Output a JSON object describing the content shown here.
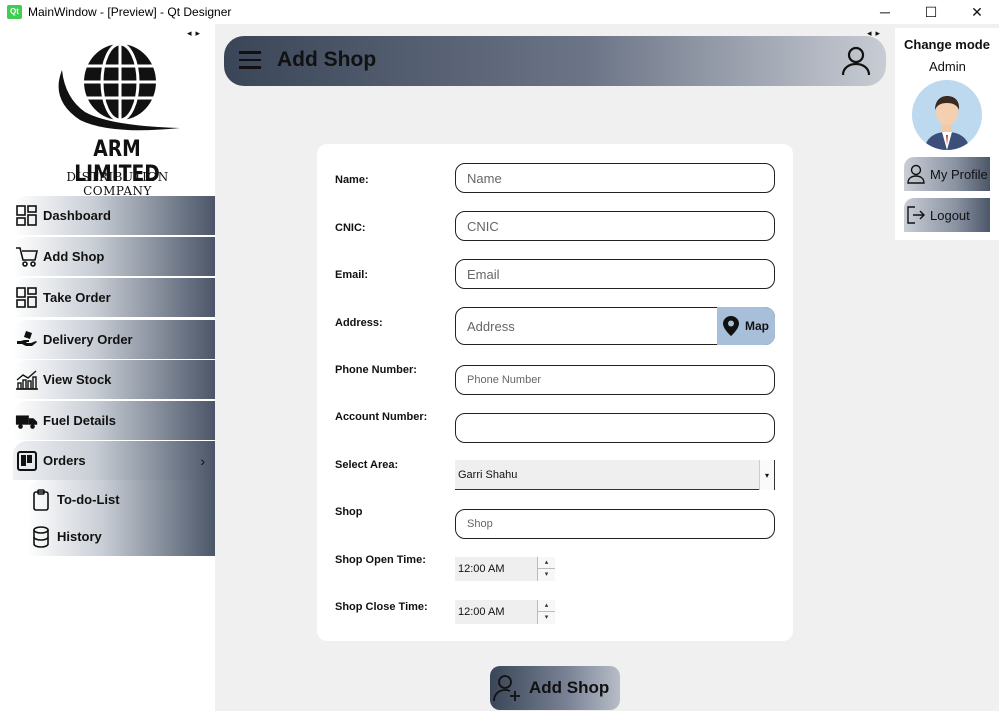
{
  "window": {
    "title": "MainWindow - [Preview] - Qt Designer",
    "qt_logo_text": "Qt",
    "minimize_glyph": "─",
    "maximize_glyph": "☐",
    "close_glyph": "✕"
  },
  "splitter_arrows": "◂▸",
  "brand": {
    "name": "ARM LIMITED",
    "subtitle": "DISTRIBUTION COMPANY"
  },
  "sidebar": {
    "items": [
      {
        "label": "Dashboard",
        "icon": "dashboard-grid-icon"
      },
      {
        "label": "Add Shop",
        "icon": "cart-icon"
      },
      {
        "label": "Take Order",
        "icon": "order-grid-icon"
      },
      {
        "label": "Delivery Order",
        "icon": "delivery-hand-icon"
      },
      {
        "label": "View Stock",
        "icon": "stock-chart-icon"
      },
      {
        "label": "Fuel Details",
        "icon": "truck-icon"
      },
      {
        "label": "Orders",
        "icon": "kanban-icon",
        "chevron": "›"
      }
    ],
    "sub_items": [
      {
        "label": "To-do-List",
        "icon": "clipboard-icon"
      },
      {
        "label": "History",
        "icon": "database-icon"
      }
    ]
  },
  "header": {
    "title": "Add Shop"
  },
  "right_panel": {
    "change_mode": "Change mode",
    "role": "Admin",
    "my_profile": "My Profile",
    "logout": "Logout"
  },
  "form": {
    "name": {
      "label": "Name:",
      "placeholder": "Name",
      "value": ""
    },
    "cnic": {
      "label": "CNIC:",
      "placeholder": "CNIC",
      "value": ""
    },
    "email": {
      "label": "Email:",
      "placeholder": "Email",
      "value": ""
    },
    "address": {
      "label": "Address:",
      "placeholder": "Address",
      "value": "",
      "map_label": "Map"
    },
    "phone": {
      "label": "Phone Number:",
      "placeholder": "Phone Number",
      "value": ""
    },
    "account": {
      "label": "Account Number:",
      "placeholder": "",
      "value": ""
    },
    "area": {
      "label": "Select Area:",
      "selected": "Garri Shahu",
      "arrow": "▾"
    },
    "shop": {
      "label": "Shop",
      "placeholder": "Shop",
      "value": ""
    },
    "open_time": {
      "label": "Shop Open Time:",
      "value": "12:00 AM"
    },
    "close_time": {
      "label": "Shop Close Time:",
      "value": "12:00 AM"
    },
    "spin_up": "▴",
    "spin_down": "▾"
  },
  "submit": {
    "label": "Add Shop"
  },
  "colors": {
    "accent_dark": "#3a4558",
    "map_button": "#a8bfd9",
    "body_bg": "#f0f0f0"
  }
}
